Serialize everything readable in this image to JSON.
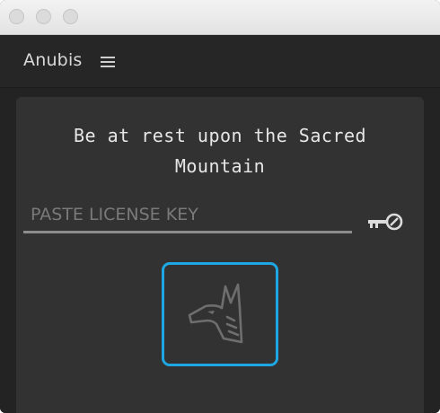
{
  "window": {
    "controls": [
      "close",
      "minimize",
      "zoom"
    ]
  },
  "panel": {
    "title": "Anubis",
    "menu_icon": "hamburger-menu-icon"
  },
  "main": {
    "motto_line1": "Be at rest upon the Sacred",
    "motto_line2": "Mountain",
    "license_input": {
      "placeholder": "PASTE LICENSE KEY",
      "value": ""
    },
    "key_button_icon": "key-icon",
    "anubis_button_icon": "anubis-head-icon"
  },
  "colors": {
    "accent": "#1fa7e3",
    "panel_bg": "#323232",
    "frame_bg": "#232323",
    "text": "#e6e6e6",
    "muted": "#7a7a7a"
  }
}
